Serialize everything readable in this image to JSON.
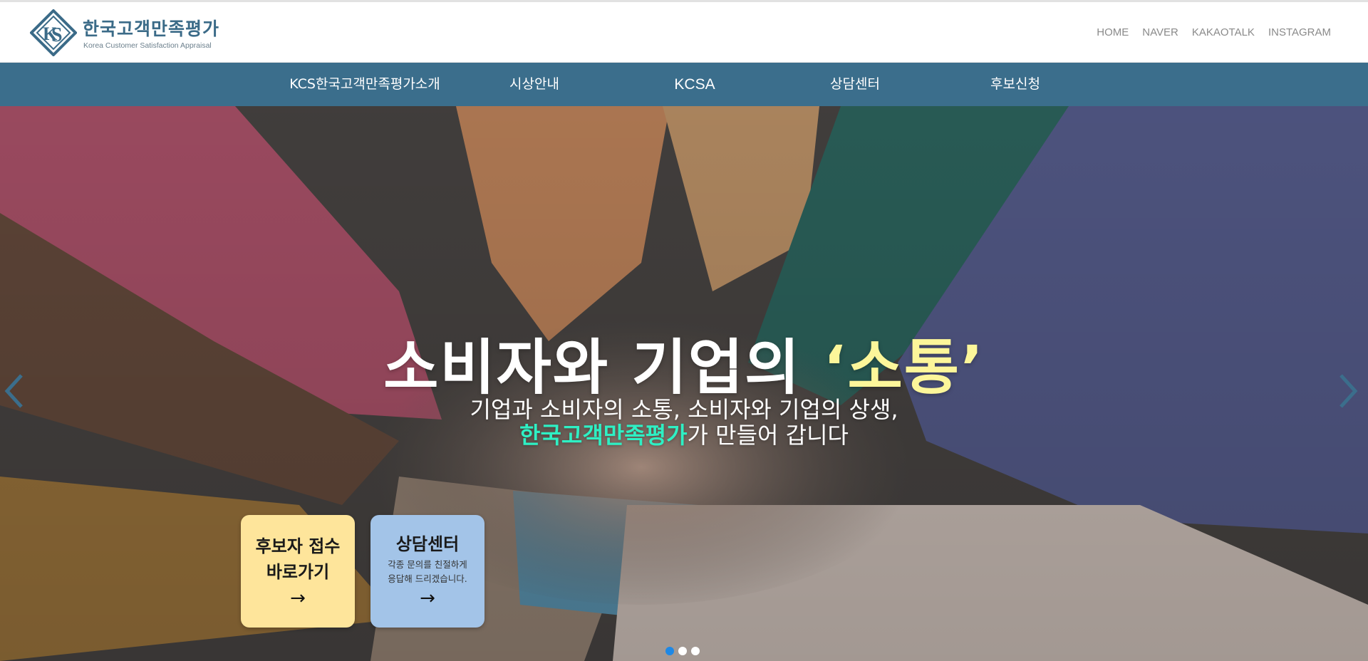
{
  "header": {
    "logo_title": "한국고객만족평가",
    "logo_subtitle": "Korea Customer Satisfaction Appraisal",
    "top_links": [
      "HOME",
      "NAVER",
      "KAKAOTALK",
      "INSTAGRAM"
    ]
  },
  "nav": {
    "items": [
      "KCS한국고객만족평가소개",
      "시상안내",
      "KCSA",
      "상담센터",
      "후보신청"
    ]
  },
  "hero": {
    "title_main": "소비자와 기업의 ",
    "title_highlight": "‘소통’",
    "subtitle_line1": "기업과 소비자의 소통, 소비자와 기업의 상생,",
    "subtitle_highlight": "한국고객만족평가",
    "subtitle_line2_rest": "가 만들어 갑니다",
    "highlight_title_color": "#fcf69a",
    "highlight_sub_color": "#2ef0c4"
  },
  "cards": {
    "apply": {
      "line1": "후보자 접수",
      "line2": "바로가기",
      "arrow": "→",
      "color": "#fee59b"
    },
    "consult": {
      "title": "상담센터",
      "desc1": "각종 문의를 친절하게",
      "desc2": "응답해 드리겠습니다.",
      "arrow": "→",
      "color": "#a3c4e8"
    }
  },
  "carousel": {
    "slide_count": 3,
    "active_index": 0,
    "icons": [
      "chevron-left-icon",
      "chevron-right-icon"
    ]
  },
  "colors": {
    "nav_bg": "#3b6e8c",
    "brand": "#3b6b88",
    "active_dot": "#1e88e5"
  }
}
